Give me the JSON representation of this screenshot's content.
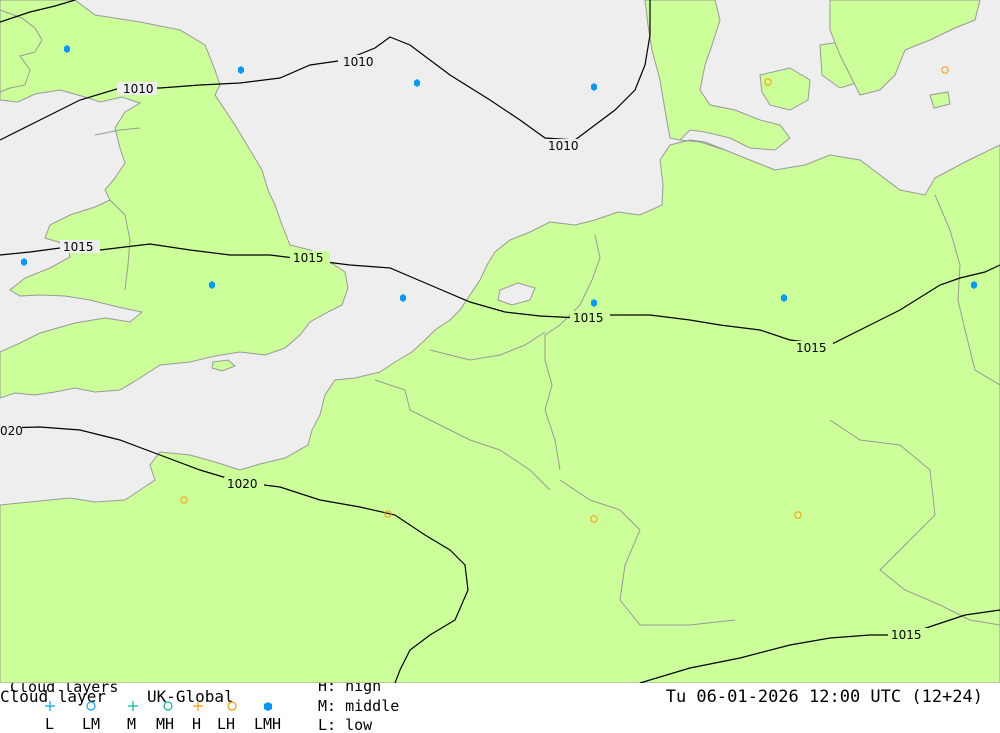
{
  "map": {
    "colors": {
      "sea": "#eeeeee",
      "land": "#ccff99",
      "border": "#999999",
      "isobar": "#000000",
      "low_cloud": "#0099ff",
      "high_cloud": "#ff9900"
    },
    "isobars": [
      {
        "value": "1010",
        "labels": [
          "1010",
          "1010",
          "1010"
        ]
      },
      {
        "value": "1015",
        "labels": [
          "1015",
          "1015",
          "1015",
          "1015",
          "1015"
        ]
      },
      {
        "value": "1020",
        "labels": [
          "020",
          "1020"
        ]
      }
    ]
  },
  "footer": {
    "title_over": "Cloud layers",
    "title": "Cloud layer",
    "model": "UK-Global",
    "legend_codes": [
      "L",
      "LM",
      "M",
      "MH",
      "H",
      "LH",
      "LMH"
    ],
    "legend_icons": [
      "plus-cyan-icon",
      "circle-cyan-icon",
      "plus-teal-icon",
      "circle-teal-icon",
      "plus-orange-icon",
      "circle-orange-icon",
      "hexagon-blue-icon"
    ],
    "key_high": "H: high",
    "key_middle": "M: middle",
    "key_low": "L: low",
    "datetime": "Tu 06-01-2026 12:00 UTC (12+24)"
  }
}
